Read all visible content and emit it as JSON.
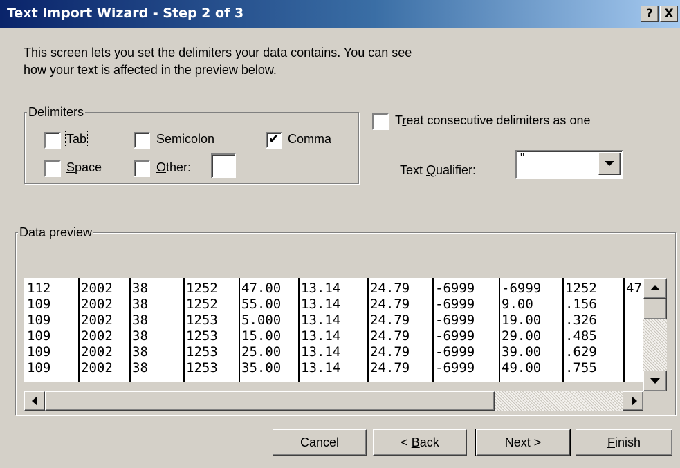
{
  "window": {
    "title": "Text Import Wizard - Step 2 of 3",
    "help_label": "?",
    "close_label": "X"
  },
  "intro": {
    "line1": "This screen lets you set the delimiters your data contains.  You can see",
    "line2": "how your text is affected in the preview below."
  },
  "delimiters": {
    "legend": "Delimiters",
    "tab": {
      "pre": "",
      "key": "T",
      "post": "ab",
      "checked": false
    },
    "semicolon": {
      "pre": "Se",
      "key": "m",
      "post": "icolon",
      "checked": false
    },
    "comma": {
      "pre": "",
      "key": "C",
      "post": "omma",
      "checked": true
    },
    "space": {
      "pre": "",
      "key": "S",
      "post": "pace",
      "checked": false
    },
    "other": {
      "pre": "",
      "key": "O",
      "post": "ther:",
      "checked": false,
      "value": ""
    }
  },
  "options": {
    "consecutive": {
      "pre": "T",
      "key": "r",
      "post": "eat consecutive delimiters as one",
      "checked": false
    },
    "qualifier_pre": "Text ",
    "qualifier_key": "Q",
    "qualifier_post": "ualifier:",
    "qualifier_value": "\""
  },
  "preview": {
    "legend": "Data preview",
    "rows": [
      [
        "112",
        "2002",
        "38",
        "1252",
        "47.00",
        "13.14",
        "24.79",
        "-6999",
        "-6999",
        "1252",
        "47"
      ],
      [
        "109",
        "2002",
        "38",
        "1252",
        "55.00",
        "13.14",
        "24.79",
        "-6999",
        "9.00",
        ".156",
        ""
      ],
      [
        "109",
        "2002",
        "38",
        "1253",
        "5.000",
        "13.14",
        "24.79",
        "-6999",
        "19.00",
        ".326",
        ""
      ],
      [
        "109",
        "2002",
        "38",
        "1253",
        "15.00",
        "13.14",
        "24.79",
        "-6999",
        "29.00",
        ".485",
        ""
      ],
      [
        "109",
        "2002",
        "38",
        "1253",
        "25.00",
        "13.14",
        "24.79",
        "-6999",
        "39.00",
        ".629",
        ""
      ],
      [
        "109",
        "2002",
        "38",
        "1253",
        "35.00",
        "13.14",
        "24.79",
        "-6999",
        "49.00",
        ".755",
        ""
      ]
    ]
  },
  "buttons": {
    "cancel": "Cancel",
    "back_pre": "< ",
    "back_key": "B",
    "back_post": "ack",
    "next": "Next >",
    "finish_key": "F",
    "finish_post": "inish"
  },
  "colors": {
    "face": "#d4d0c8",
    "title_start": "#0a246a",
    "title_end": "#a6caf0"
  }
}
